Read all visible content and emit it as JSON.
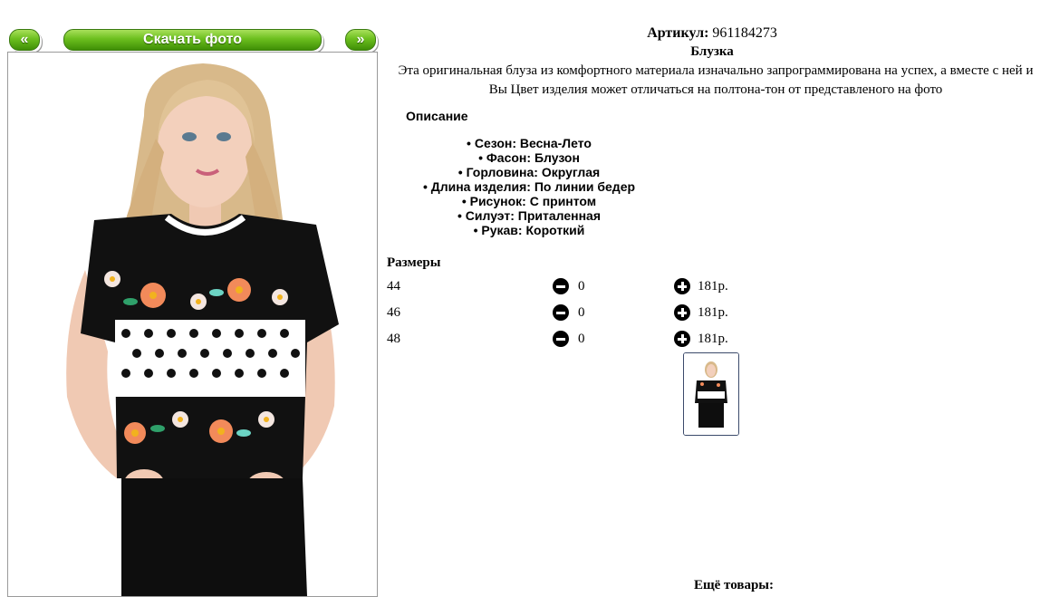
{
  "nav": {
    "prev_label": "«",
    "download_label": "Скачать фото",
    "next_label": "»"
  },
  "product": {
    "article_label": "Артикул:",
    "article_value": "961184273",
    "title": "Блузка",
    "description": "Эта оригинальная блуза из комфортного материала изначально запрограммирована на успех, а вместе с ней и Вы Цвет изделия может отличаться на полтона-тон от представленого на фото",
    "details_heading": "Описание",
    "features": [
      "Сезон: Весна-Лето",
      "Фасон: Блузон",
      "Горловина: Округлая",
      "Длина изделия: По линии бедер",
      "Рисунок: С принтом",
      "Силуэт: Приталенная",
      "Рукав: Короткий"
    ]
  },
  "sizes": {
    "heading": "Размеры",
    "rows": [
      {
        "size": "44",
        "qty": "0",
        "price": "181р."
      },
      {
        "size": "46",
        "qty": "0",
        "price": "181р."
      },
      {
        "size": "48",
        "qty": "0",
        "price": "181р."
      }
    ]
  },
  "more_heading": "Ещё товары:",
  "icons": {
    "decrease": "minus-circle-icon",
    "increase": "plus-circle-icon"
  },
  "colors": {
    "button_green": "#6cbf1e",
    "thumb_border": "#3b4a6b"
  }
}
